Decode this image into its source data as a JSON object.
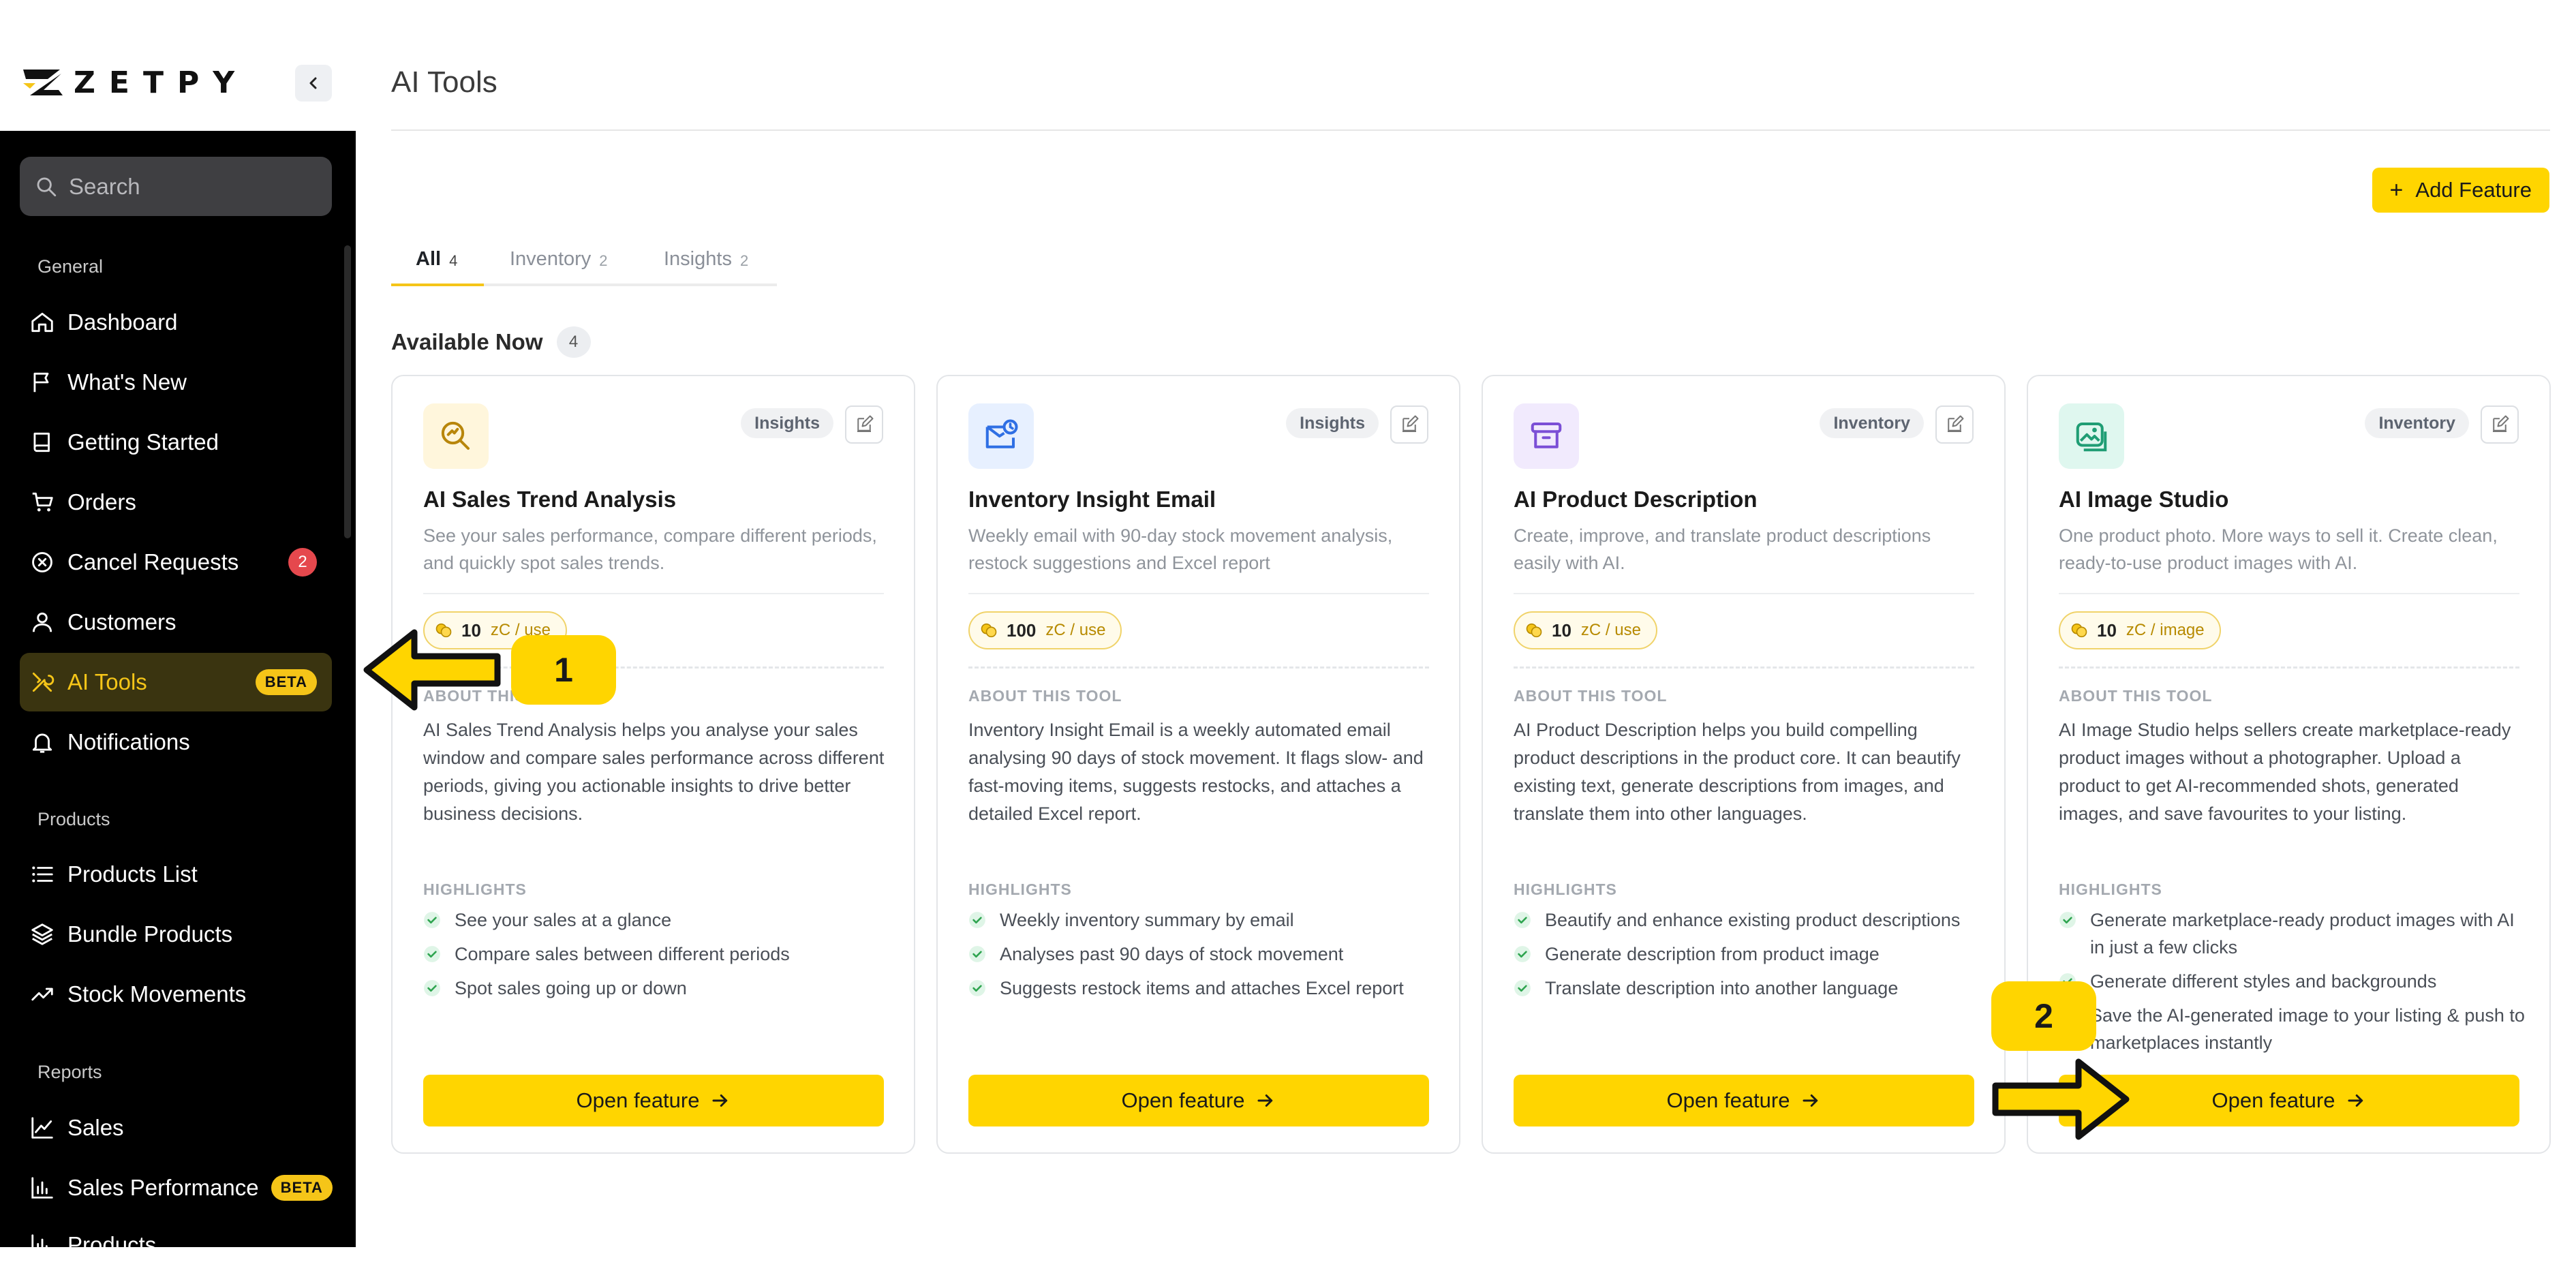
{
  "brand": {
    "name": "ZETPY",
    "accent": "#ffd500"
  },
  "sidebar": {
    "search_placeholder": "Search",
    "sections": [
      {
        "heading": "General",
        "items": [
          {
            "label": "Dashboard",
            "icon": "home-icon"
          },
          {
            "label": "What's New",
            "icon": "flag-icon"
          },
          {
            "label": "Getting Started",
            "icon": "book-icon"
          },
          {
            "label": "Orders",
            "icon": "cart-icon"
          },
          {
            "label": "Cancel Requests",
            "icon": "cancel-circle-icon",
            "badge": "2"
          },
          {
            "label": "Customers",
            "icon": "user-icon"
          },
          {
            "label": "AI Tools",
            "icon": "tools-icon",
            "badge": "BETA",
            "active": true
          },
          {
            "label": "Notifications",
            "icon": "bell-icon"
          }
        ]
      },
      {
        "heading": "Products",
        "items": [
          {
            "label": "Products List",
            "icon": "list-icon"
          },
          {
            "label": "Bundle Products",
            "icon": "layers-icon"
          },
          {
            "label": "Stock Movements",
            "icon": "trend-icon"
          }
        ]
      },
      {
        "heading": "Reports",
        "items": [
          {
            "label": "Sales",
            "icon": "line-chart-icon"
          },
          {
            "label": "Sales Performance",
            "icon": "bar-chart-icon",
            "badge": "BETA"
          },
          {
            "label": "Products",
            "icon": "bar-chart-icon"
          }
        ]
      }
    ]
  },
  "header": {
    "title": "AI Tools",
    "add_button": "Add Feature"
  },
  "tabs": [
    {
      "label": "All",
      "count": "4",
      "active": true
    },
    {
      "label": "Inventory",
      "count": "2"
    },
    {
      "label": "Insights",
      "count": "2"
    }
  ],
  "section": {
    "title": "Available Now",
    "count": "4"
  },
  "labels": {
    "about": "ABOUT THIS TOOL",
    "highlights": "HIGHLIGHTS",
    "open": "Open feature"
  },
  "cards": [
    {
      "title": "AI Sales Trend Analysis",
      "tag": "Insights",
      "icon": "sales-trend-icon",
      "desc": "See your sales performance, compare different periods, and quickly spot sales trends.",
      "price": "10",
      "unit": "zC / use",
      "about": "AI Sales Trend Analysis helps you analyse your sales window and compare sales performance across different periods, giving you actionable insights to drive better business decisions.",
      "highlights": [
        "See your sales at a glance",
        "Compare sales between different periods",
        "Spot sales going up or down"
      ]
    },
    {
      "title": "Inventory Insight Email",
      "tag": "Insights",
      "icon": "mail-clock-icon",
      "desc": "Weekly email with 90-day stock movement analysis, restock suggestions and Excel report",
      "price": "100",
      "unit": "zC / use",
      "about": "Inventory Insight Email is a weekly automated email analysing 90 days of stock movement. It flags slow- and fast-moving items, suggests restocks, and attaches a detailed Excel report.",
      "highlights": [
        "Weekly inventory summary by email",
        "Analyses past 90 days of stock movement",
        "Suggests restock items and attaches Excel report"
      ]
    },
    {
      "title": "AI Product Description",
      "tag": "Inventory",
      "icon": "archive-box-icon",
      "desc": "Create, improve, and translate product descriptions easily with AI.",
      "price": "10",
      "unit": "zC / use",
      "about": "AI Product Description helps you build compelling product descriptions in the product core. It can beautify existing text, generate descriptions from images, and translate them into other languages.",
      "highlights": [
        "Beautify and enhance existing product descriptions",
        "Generate description from product image",
        "Translate description into another language"
      ]
    },
    {
      "title": "AI Image Studio",
      "tag": "Inventory",
      "icon": "image-studio-icon",
      "desc": "One product photo. More ways to sell it. Create clean, ready-to-use product images with AI.",
      "price": "10",
      "unit": "zC / image",
      "about": "AI Image Studio helps sellers create marketplace-ready product images without a photographer. Upload a product to get AI-recommended shots, generated images, and save favourites to your listing.",
      "highlights": [
        "Generate marketplace-ready product images with AI in just a few clicks",
        "Generate different styles and backgrounds",
        "Save the AI-generated image to your listing & push to marketplaces instantly"
      ]
    }
  ],
  "callouts": [
    "1",
    "2"
  ]
}
